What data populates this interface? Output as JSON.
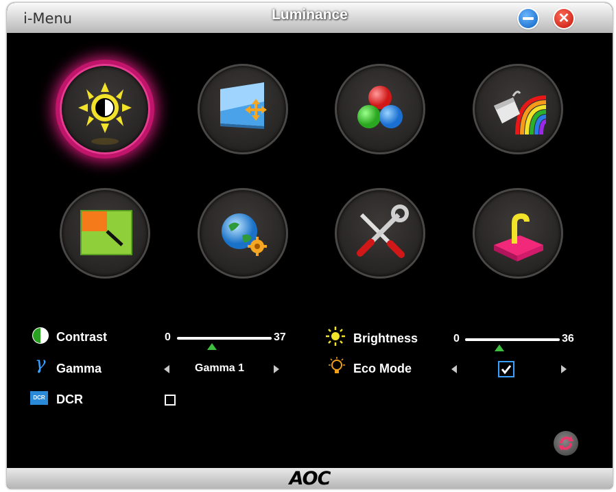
{
  "window": {
    "app_name": "i-Menu",
    "title": "Luminance",
    "brand": "AOC"
  },
  "titlebar": {
    "minimize_icon": "minus-circle-icon",
    "close_icon": "x-circle-icon",
    "close_glyph": "✕"
  },
  "categories": [
    {
      "id": "luminance",
      "icon": "sun-contrast-icon",
      "active": true
    },
    {
      "id": "image-setup",
      "icon": "screen-move-icon",
      "active": false
    },
    {
      "id": "color-setup",
      "icon": "rgb-balls-icon",
      "active": false
    },
    {
      "id": "picture-boost",
      "icon": "rainbow-bucket-icon",
      "active": false
    },
    {
      "id": "osd-setup",
      "icon": "window-layout-icon",
      "active": false
    },
    {
      "id": "extra",
      "icon": "globe-gear-icon",
      "active": false
    },
    {
      "id": "factory-reset",
      "icon": "tools-icon",
      "active": false
    },
    {
      "id": "exit",
      "icon": "exit-door-icon",
      "active": false
    }
  ],
  "settings": {
    "contrast": {
      "label": "Contrast",
      "min": "0",
      "value": "37",
      "position": 0.37
    },
    "brightness": {
      "label": "Brightness",
      "min": "0",
      "value": "36",
      "position": 0.36
    },
    "gamma": {
      "label": "Gamma",
      "value": "Gamma 1"
    },
    "eco_mode": {
      "label": "Eco Mode",
      "checked": true
    },
    "dcr": {
      "label": "DCR",
      "checked": false,
      "icon_text": "DCR"
    }
  },
  "colors": {
    "accent": "#d01a78",
    "slider_thumb": "#3fbf3f",
    "checkbox": "#3aa0ff"
  }
}
